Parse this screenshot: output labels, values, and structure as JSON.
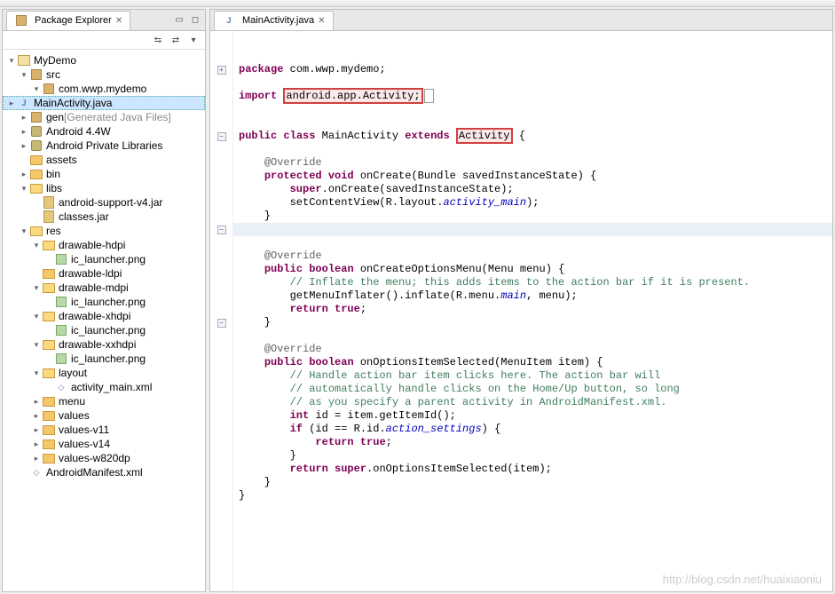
{
  "explorer": {
    "title": "Package Explorer",
    "tree": [
      {
        "d": 0,
        "tw": "v",
        "icon": "proj",
        "label": "MyDemo"
      },
      {
        "d": 1,
        "tw": "v",
        "icon": "pkg",
        "label": "src"
      },
      {
        "d": 2,
        "tw": "v",
        "icon": "pkg",
        "label": "com.wwp.mydemo"
      },
      {
        "d": 3,
        "tw": ">",
        "icon": "java",
        "label": "MainActivity.java",
        "sel": true
      },
      {
        "d": 1,
        "tw": ">",
        "icon": "pkg",
        "label": "gen ",
        "extra": "[Generated Java Files]"
      },
      {
        "d": 1,
        "tw": ">",
        "icon": "lib",
        "label": "Android 4.4W"
      },
      {
        "d": 1,
        "tw": ">",
        "icon": "lib",
        "label": "Android Private Libraries"
      },
      {
        "d": 1,
        "tw": "",
        "icon": "folder",
        "label": "assets"
      },
      {
        "d": 1,
        "tw": ">",
        "icon": "folder",
        "label": "bin"
      },
      {
        "d": 1,
        "tw": "v",
        "icon": "folder-open",
        "label": "libs"
      },
      {
        "d": 2,
        "tw": "",
        "icon": "jar",
        "label": "android-support-v4.jar"
      },
      {
        "d": 2,
        "tw": "",
        "icon": "jar",
        "label": "classes.jar"
      },
      {
        "d": 1,
        "tw": "v",
        "icon": "folder-open",
        "label": "res"
      },
      {
        "d": 2,
        "tw": "v",
        "icon": "folder-open",
        "label": "drawable-hdpi"
      },
      {
        "d": 3,
        "tw": "",
        "icon": "img",
        "label": "ic_launcher.png"
      },
      {
        "d": 2,
        "tw": "",
        "icon": "folder",
        "label": "drawable-ldpi"
      },
      {
        "d": 2,
        "tw": "v",
        "icon": "folder-open",
        "label": "drawable-mdpi"
      },
      {
        "d": 3,
        "tw": "",
        "icon": "img",
        "label": "ic_launcher.png"
      },
      {
        "d": 2,
        "tw": "v",
        "icon": "folder-open",
        "label": "drawable-xhdpi"
      },
      {
        "d": 3,
        "tw": "",
        "icon": "img",
        "label": "ic_launcher.png"
      },
      {
        "d": 2,
        "tw": "v",
        "icon": "folder-open",
        "label": "drawable-xxhdpi"
      },
      {
        "d": 3,
        "tw": "",
        "icon": "img",
        "label": "ic_launcher.png"
      },
      {
        "d": 2,
        "tw": "v",
        "icon": "folder-open",
        "label": "layout"
      },
      {
        "d": 3,
        "tw": "",
        "icon": "xml",
        "label": "activity_main.xml"
      },
      {
        "d": 2,
        "tw": ">",
        "icon": "folder",
        "label": "menu"
      },
      {
        "d": 2,
        "tw": ">",
        "icon": "folder",
        "label": "values"
      },
      {
        "d": 2,
        "tw": ">",
        "icon": "folder",
        "label": "values-v11"
      },
      {
        "d": 2,
        "tw": ">",
        "icon": "folder",
        "label": "values-v14"
      },
      {
        "d": 2,
        "tw": ">",
        "icon": "folder",
        "label": "values-w820dp"
      },
      {
        "d": 1,
        "tw": "",
        "icon": "xml",
        "label": "AndroidManifest.xml"
      }
    ]
  },
  "editor": {
    "tab_label": "MainActivity.java",
    "code_lines": [
      {
        "g": "",
        "html": "<span class='kw'>package</span> com.wwp.mydemo;"
      },
      {
        "g": "",
        "html": ""
      },
      {
        "g": "plus",
        "html": "<span class='kw'>import</span> <span class='hl-box'>android.app.Activity;</span><span style='border:1px solid #999;padding:0 1px;margin-left:1px;'>&nbsp;</span>"
      },
      {
        "g": "",
        "html": ""
      },
      {
        "g": "",
        "html": ""
      },
      {
        "g": "",
        "html": "<span class='kw'>public</span> <span class='kw'>class</span> MainActivity <span class='kw'>extends</span> <span class='hl-box'>Activity</span> {"
      },
      {
        "g": "",
        "html": ""
      },
      {
        "g": "minus",
        "html": "    <span class='ann'>@Override</span>"
      },
      {
        "g": "",
        "html": "    <span class='kw'>protected</span> <span class='kw'>void</span> onCreate(Bundle savedInstanceState) {"
      },
      {
        "g": "",
        "html": "        <span class='kw'>super</span>.onCreate(savedInstanceState);"
      },
      {
        "g": "",
        "html": "        setContentView(R.layout.<span class='stc'>activity_main</span>);"
      },
      {
        "g": "",
        "html": "    }"
      },
      {
        "g": "",
        "html": "<span class='cursor-line'>    </span>"
      },
      {
        "g": "",
        "html": ""
      },
      {
        "g": "minus",
        "html": "    <span class='ann'>@Override</span>"
      },
      {
        "g": "",
        "html": "    <span class='kw'>public</span> <span class='kw'>boolean</span> onCreateOptionsMenu(Menu menu) {"
      },
      {
        "g": "",
        "html": "        <span class='cmt'>// Inflate the menu; this adds items to the action bar if it is present.</span>"
      },
      {
        "g": "",
        "html": "        getMenuInflater().inflate(R.menu.<span class='stc'>main</span>, menu);"
      },
      {
        "g": "",
        "html": "        <span class='kw'>return</span> <span class='kw'>true</span>;"
      },
      {
        "g": "",
        "html": "    }"
      },
      {
        "g": "",
        "html": ""
      },
      {
        "g": "minus",
        "html": "    <span class='ann'>@Override</span>"
      },
      {
        "g": "",
        "html": "    <span class='kw'>public</span> <span class='kw'>boolean</span> onOptionsItemSelected(MenuItem item) {"
      },
      {
        "g": "",
        "html": "        <span class='cmt'>// Handle action bar item clicks here. The action bar will</span>"
      },
      {
        "g": "",
        "html": "        <span class='cmt'>// automatically handle clicks on the Home/Up button, so long</span>"
      },
      {
        "g": "",
        "html": "        <span class='cmt'>// as you specify a parent activity in AndroidManifest.xml.</span>"
      },
      {
        "g": "",
        "html": "        <span class='kw'>int</span> id = item.getItemId();"
      },
      {
        "g": "",
        "html": "        <span class='kw'>if</span> (id == R.id.<span class='stc'>action_settings</span>) {"
      },
      {
        "g": "",
        "html": "            <span class='kw'>return</span> <span class='kw'>true</span>;"
      },
      {
        "g": "",
        "html": "        }"
      },
      {
        "g": "",
        "html": "        <span class='kw'>return</span> <span class='kw'>super</span>.onOptionsItemSelected(item);"
      },
      {
        "g": "",
        "html": "    }"
      },
      {
        "g": "",
        "html": "}"
      }
    ]
  },
  "watermark": "http://blog.csdn.net/huaixiaoniu"
}
